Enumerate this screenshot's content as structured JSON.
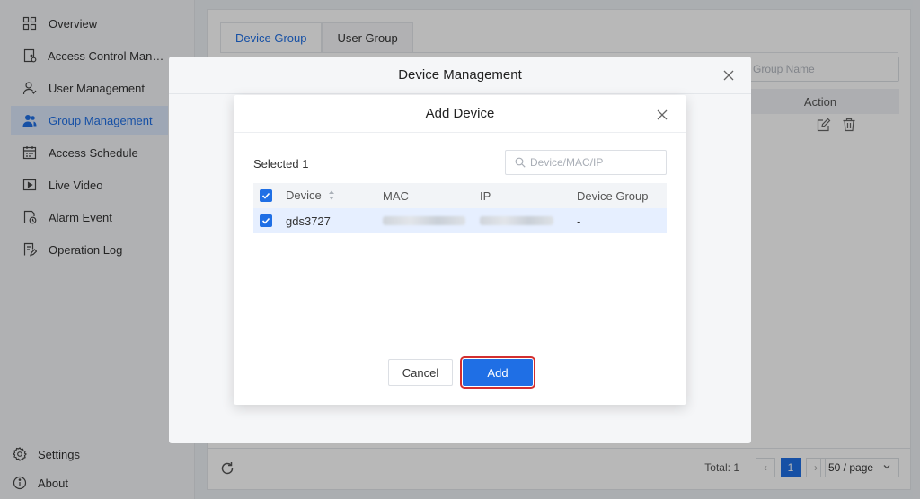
{
  "sidebar": {
    "items": [
      {
        "label": "Overview",
        "icon": "grid-icon"
      },
      {
        "label": "Access Control Manag...",
        "icon": "door-icon"
      },
      {
        "label": "User Management",
        "icon": "user-icon"
      },
      {
        "label": "Group Management",
        "icon": "group-icon",
        "active": true
      },
      {
        "label": "Access Schedule",
        "icon": "calendar-icon"
      },
      {
        "label": "Live Video",
        "icon": "video-icon"
      },
      {
        "label": "Alarm Event",
        "icon": "alarm-icon"
      },
      {
        "label": "Operation Log",
        "icon": "log-icon"
      }
    ],
    "settings_label": "Settings",
    "about_label": "About"
  },
  "main": {
    "tabs": [
      "Device Group",
      "User Group"
    ],
    "search_placeholder": "Group Name",
    "action_header": "Action",
    "pagination": {
      "total_label": "Total: 1",
      "current_page": "1",
      "per_page": "50 / page"
    }
  },
  "outer_dialog": {
    "title": "Device Management"
  },
  "inner_dialog": {
    "title": "Add Device",
    "selected_label": "Selected 1",
    "search_placeholder": "Device/MAC/IP",
    "columns": [
      "Device",
      "MAC",
      "IP",
      "Device Group"
    ],
    "rows": [
      {
        "device": "gds3727",
        "device_group": "-"
      }
    ],
    "cancel_label": "Cancel",
    "add_label": "Add"
  },
  "colors": {
    "accent": "#1f6fe5",
    "highlight_outline": "#d32f2f"
  }
}
